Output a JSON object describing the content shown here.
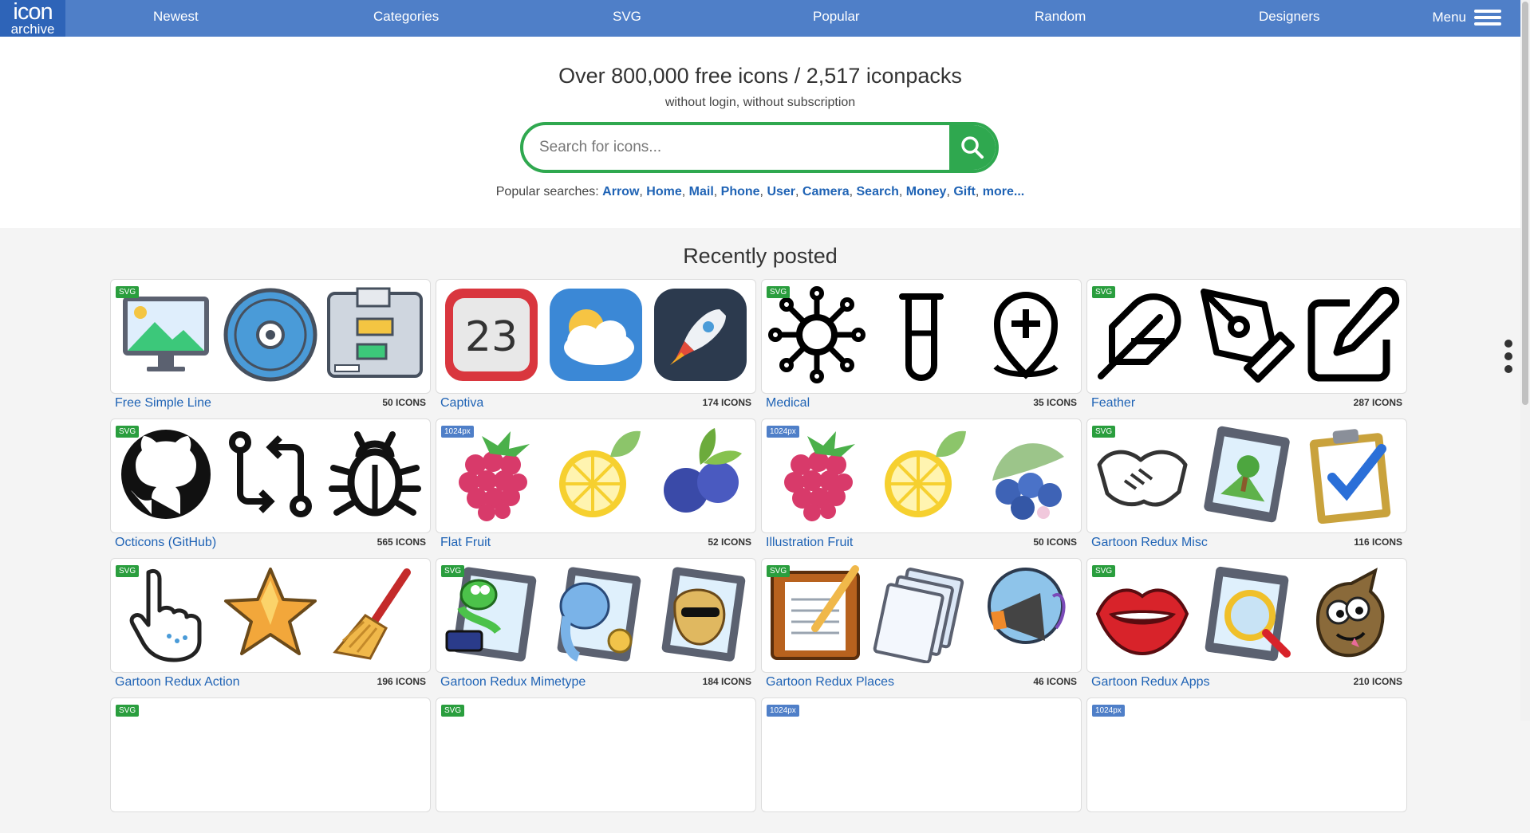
{
  "logo": {
    "line1": "icon",
    "line2": "archive"
  },
  "nav": [
    {
      "label": "Newest"
    },
    {
      "label": "Categories"
    },
    {
      "label": "SVG"
    },
    {
      "label": "Popular"
    },
    {
      "label": "Random"
    },
    {
      "label": "Designers"
    }
  ],
  "menu_label": "Menu",
  "hero": {
    "title": "Over 800,000 free icons / 2,517 iconpacks",
    "subtitle": "without login, without subscription"
  },
  "search": {
    "placeholder": "Search for icons..."
  },
  "popular": {
    "label": "Popular searches:",
    "terms": [
      "Arrow",
      "Home",
      "Mail",
      "Phone",
      "User",
      "Camera",
      "Search",
      "Money",
      "Gift",
      "more..."
    ]
  },
  "section_title": "Recently posted",
  "packs": [
    {
      "name": "Free Simple Line",
      "count": "50 ICONS",
      "badge": "SVG",
      "icons": [
        "monitor-landscape-icon",
        "disc-icon",
        "flowchart-icon"
      ]
    },
    {
      "name": "Captiva",
      "count": "174 ICONS",
      "badge": "",
      "icons": [
        "calendar-icon",
        "weather-icon",
        "rocket-icon"
      ]
    },
    {
      "name": "Medical",
      "count": "35 ICONS",
      "badge": "SVG",
      "icons": [
        "virus-icon",
        "test-tube-icon",
        "location-plus-icon"
      ]
    },
    {
      "name": "Feather",
      "count": "287 ICONS",
      "badge": "SVG",
      "icons": [
        "feather-icon",
        "pen-tool-icon",
        "edit-icon"
      ]
    },
    {
      "name": "Octicons (GitHub)",
      "count": "565 ICONS",
      "badge": "SVG",
      "icons": [
        "github-icon",
        "git-compare-icon",
        "bug-icon"
      ]
    },
    {
      "name": "Flat Fruit",
      "count": "52 ICONS",
      "badge": "1024px",
      "icons": [
        "raspberry-icon",
        "lemon-icon",
        "blueberry-icon"
      ]
    },
    {
      "name": "Illustration Fruit",
      "count": "50 ICONS",
      "badge": "1024px",
      "icons": [
        "raspberry-icon",
        "lemon-icon",
        "blueberries-icon"
      ]
    },
    {
      "name": "Gartoon Redux Misc",
      "count": "116 ICONS",
      "badge": "SVG",
      "icons": [
        "handshake-icon",
        "image-icon",
        "clipboard-check-icon"
      ]
    },
    {
      "name": "Gartoon Redux Action",
      "count": "196 ICONS",
      "badge": "SVG",
      "icons": [
        "pointer-hand-icon",
        "star-icon",
        "broom-icon"
      ]
    },
    {
      "name": "Gartoon Redux Mimetype",
      "count": "184 ICONS",
      "badge": "SVG",
      "icons": [
        "python-file-icon",
        "php-file-icon",
        "perl-file-icon"
      ]
    },
    {
      "name": "Gartoon Redux Places",
      "count": "46 ICONS",
      "badge": "SVG",
      "icons": [
        "notepad-icon",
        "documents-icon",
        "megaphone-icon"
      ]
    },
    {
      "name": "Gartoon Redux Apps",
      "count": "210 ICONS",
      "badge": "SVG",
      "icons": [
        "lips-icon",
        "image-viewer-icon",
        "gimp-icon"
      ]
    },
    {
      "name": "",
      "count": "",
      "badge": "SVG",
      "icons": []
    },
    {
      "name": "",
      "count": "",
      "badge": "SVG",
      "icons": []
    },
    {
      "name": "",
      "count": "",
      "badge": "1024px",
      "icons": []
    },
    {
      "name": "",
      "count": "",
      "badge": "1024px",
      "icons": []
    }
  ],
  "colors": {
    "brand_blue": "#4f7fc8",
    "logo_blue": "#2e64b8",
    "search_green": "#2fa84f",
    "link_blue": "#1f63b5"
  }
}
